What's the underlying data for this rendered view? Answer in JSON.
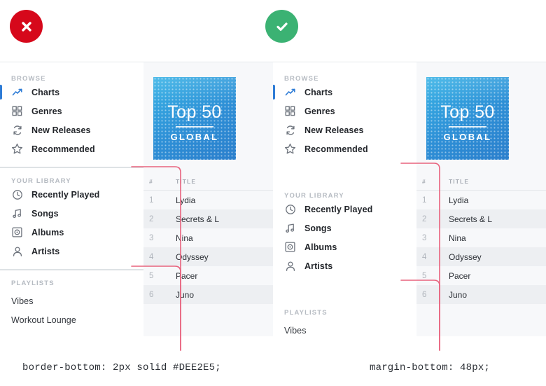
{
  "badges": {
    "bad": {
      "icon": "x-icon",
      "color": "#D6081B",
      "meaning": "incorrect"
    },
    "good": {
      "icon": "check-icon",
      "color": "#3BB273",
      "meaning": "correct"
    }
  },
  "captions": {
    "left": "border-bottom: 2px solid #DEE2E5;",
    "right": "margin-bottom: 48px;"
  },
  "sidebar": {
    "sections": [
      {
        "heading": "BROWSE",
        "items": [
          {
            "label": "Charts",
            "icon": "trend-arrow-icon",
            "active": true
          },
          {
            "label": "Genres",
            "icon": "grid-icon",
            "active": false
          },
          {
            "label": "New Releases",
            "icon": "refresh-icon",
            "active": false
          },
          {
            "label": "Recommended",
            "icon": "star-icon",
            "active": false
          }
        ]
      },
      {
        "heading": "YOUR LIBRARY",
        "items": [
          {
            "label": "Recently Played",
            "icon": "clock-icon",
            "active": false
          },
          {
            "label": "Songs",
            "icon": "music-note-icon",
            "active": false
          },
          {
            "label": "Albums",
            "icon": "album-disc-icon",
            "active": false
          },
          {
            "label": "Artists",
            "icon": "person-icon",
            "active": false
          }
        ]
      },
      {
        "heading": "PLAYLISTS",
        "items": [
          {
            "label": "Vibes",
            "icon": "",
            "active": false
          },
          {
            "label": "Workout Lounge",
            "icon": "",
            "active": false
          }
        ]
      }
    ]
  },
  "album": {
    "title": "Top 50",
    "subtitle": "GLOBAL",
    "color_start": "#39B3E6",
    "color_end": "#2B7FCC"
  },
  "tracks": {
    "columns": [
      "#",
      "TITLE"
    ],
    "rows": [
      {
        "num": "1",
        "title": "Lydia"
      },
      {
        "num": "2",
        "title": "Secrets & L"
      },
      {
        "num": "3",
        "title": "Nina"
      },
      {
        "num": "4",
        "title": "Odyssey"
      },
      {
        "num": "5",
        "title": "Pacer"
      },
      {
        "num": "6",
        "title": "Juno"
      }
    ]
  },
  "colors": {
    "divider": "#DEE2E5",
    "accent": "#2E7CD6",
    "annotation": "#E8627D",
    "row_alt": "#EDEFF2",
    "canvas": "#F7F8FA"
  }
}
